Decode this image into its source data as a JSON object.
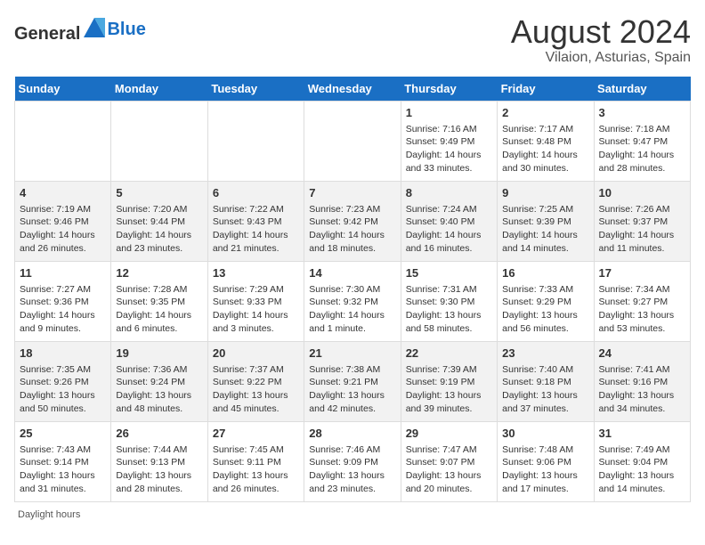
{
  "header": {
    "logo_general": "General",
    "logo_blue": "Blue",
    "title": "August 2024",
    "subtitle": "Vilaion, Asturias, Spain"
  },
  "days_of_week": [
    "Sunday",
    "Monday",
    "Tuesday",
    "Wednesday",
    "Thursday",
    "Friday",
    "Saturday"
  ],
  "weeks": [
    [
      {
        "day": "",
        "info": ""
      },
      {
        "day": "",
        "info": ""
      },
      {
        "day": "",
        "info": ""
      },
      {
        "day": "",
        "info": ""
      },
      {
        "day": "1",
        "info": "Sunrise: 7:16 AM\nSunset: 9:49 PM\nDaylight: 14 hours\nand 33 minutes."
      },
      {
        "day": "2",
        "info": "Sunrise: 7:17 AM\nSunset: 9:48 PM\nDaylight: 14 hours\nand 30 minutes."
      },
      {
        "day": "3",
        "info": "Sunrise: 7:18 AM\nSunset: 9:47 PM\nDaylight: 14 hours\nand 28 minutes."
      }
    ],
    [
      {
        "day": "4",
        "info": "Sunrise: 7:19 AM\nSunset: 9:46 PM\nDaylight: 14 hours\nand 26 minutes."
      },
      {
        "day": "5",
        "info": "Sunrise: 7:20 AM\nSunset: 9:44 PM\nDaylight: 14 hours\nand 23 minutes."
      },
      {
        "day": "6",
        "info": "Sunrise: 7:22 AM\nSunset: 9:43 PM\nDaylight: 14 hours\nand 21 minutes."
      },
      {
        "day": "7",
        "info": "Sunrise: 7:23 AM\nSunset: 9:42 PM\nDaylight: 14 hours\nand 18 minutes."
      },
      {
        "day": "8",
        "info": "Sunrise: 7:24 AM\nSunset: 9:40 PM\nDaylight: 14 hours\nand 16 minutes."
      },
      {
        "day": "9",
        "info": "Sunrise: 7:25 AM\nSunset: 9:39 PM\nDaylight: 14 hours\nand 14 minutes."
      },
      {
        "day": "10",
        "info": "Sunrise: 7:26 AM\nSunset: 9:37 PM\nDaylight: 14 hours\nand 11 minutes."
      }
    ],
    [
      {
        "day": "11",
        "info": "Sunrise: 7:27 AM\nSunset: 9:36 PM\nDaylight: 14 hours\nand 9 minutes."
      },
      {
        "day": "12",
        "info": "Sunrise: 7:28 AM\nSunset: 9:35 PM\nDaylight: 14 hours\nand 6 minutes."
      },
      {
        "day": "13",
        "info": "Sunrise: 7:29 AM\nSunset: 9:33 PM\nDaylight: 14 hours\nand 3 minutes."
      },
      {
        "day": "14",
        "info": "Sunrise: 7:30 AM\nSunset: 9:32 PM\nDaylight: 14 hours\nand 1 minute."
      },
      {
        "day": "15",
        "info": "Sunrise: 7:31 AM\nSunset: 9:30 PM\nDaylight: 13 hours\nand 58 minutes."
      },
      {
        "day": "16",
        "info": "Sunrise: 7:33 AM\nSunset: 9:29 PM\nDaylight: 13 hours\nand 56 minutes."
      },
      {
        "day": "17",
        "info": "Sunrise: 7:34 AM\nSunset: 9:27 PM\nDaylight: 13 hours\nand 53 minutes."
      }
    ],
    [
      {
        "day": "18",
        "info": "Sunrise: 7:35 AM\nSunset: 9:26 PM\nDaylight: 13 hours\nand 50 minutes."
      },
      {
        "day": "19",
        "info": "Sunrise: 7:36 AM\nSunset: 9:24 PM\nDaylight: 13 hours\nand 48 minutes."
      },
      {
        "day": "20",
        "info": "Sunrise: 7:37 AM\nSunset: 9:22 PM\nDaylight: 13 hours\nand 45 minutes."
      },
      {
        "day": "21",
        "info": "Sunrise: 7:38 AM\nSunset: 9:21 PM\nDaylight: 13 hours\nand 42 minutes."
      },
      {
        "day": "22",
        "info": "Sunrise: 7:39 AM\nSunset: 9:19 PM\nDaylight: 13 hours\nand 39 minutes."
      },
      {
        "day": "23",
        "info": "Sunrise: 7:40 AM\nSunset: 9:18 PM\nDaylight: 13 hours\nand 37 minutes."
      },
      {
        "day": "24",
        "info": "Sunrise: 7:41 AM\nSunset: 9:16 PM\nDaylight: 13 hours\nand 34 minutes."
      }
    ],
    [
      {
        "day": "25",
        "info": "Sunrise: 7:43 AM\nSunset: 9:14 PM\nDaylight: 13 hours\nand 31 minutes."
      },
      {
        "day": "26",
        "info": "Sunrise: 7:44 AM\nSunset: 9:13 PM\nDaylight: 13 hours\nand 28 minutes."
      },
      {
        "day": "27",
        "info": "Sunrise: 7:45 AM\nSunset: 9:11 PM\nDaylight: 13 hours\nand 26 minutes."
      },
      {
        "day": "28",
        "info": "Sunrise: 7:46 AM\nSunset: 9:09 PM\nDaylight: 13 hours\nand 23 minutes."
      },
      {
        "day": "29",
        "info": "Sunrise: 7:47 AM\nSunset: 9:07 PM\nDaylight: 13 hours\nand 20 minutes."
      },
      {
        "day": "30",
        "info": "Sunrise: 7:48 AM\nSunset: 9:06 PM\nDaylight: 13 hours\nand 17 minutes."
      },
      {
        "day": "31",
        "info": "Sunrise: 7:49 AM\nSunset: 9:04 PM\nDaylight: 13 hours\nand 14 minutes."
      }
    ]
  ],
  "footer": {
    "label": "Daylight hours"
  }
}
